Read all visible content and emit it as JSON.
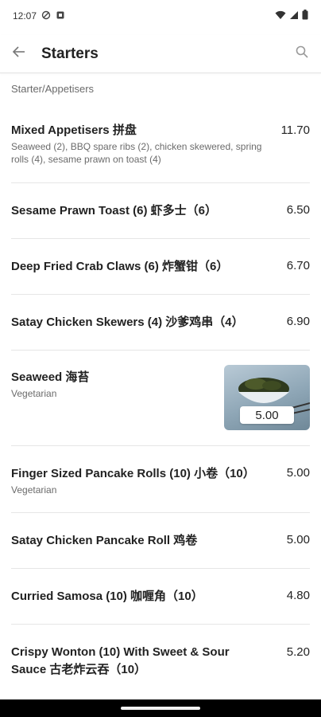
{
  "status": {
    "time": "12:07"
  },
  "header": {
    "title": "Starters"
  },
  "section": {
    "label": "Starter/Appetisers"
  },
  "items": [
    {
      "name": "Mixed Appetisers 拼盘",
      "description": "Seaweed (2), BBQ spare ribs (2), chicken skewered, spring rolls (4), sesame prawn on toast (4)",
      "price": "11.70"
    },
    {
      "name": "Sesame Prawn Toast (6) 虾多士（6）",
      "price": "6.50"
    },
    {
      "name": "Deep Fried Crab Claws (6) 炸蟹钳（6）",
      "price": "6.70"
    },
    {
      "name": "Satay Chicken Skewers (4) 沙爹鸡串（4）",
      "price": "6.90"
    },
    {
      "name": "Seaweed 海苔",
      "description": "Vegetarian",
      "price": "5.00"
    },
    {
      "name": "Finger Sized Pancake Rolls (10) 小卷（10）",
      "description": "Vegetarian",
      "price": "5.00"
    },
    {
      "name": "Satay Chicken Pancake Roll 鸡卷",
      "price": "5.00"
    },
    {
      "name": "Curried Samosa (10) 咖喱角（10）",
      "price": "4.80"
    },
    {
      "name": "Crispy Wonton (10) With Sweet & Sour Sauce 古老炸云吞（10）",
      "price": "5.20"
    }
  ],
  "colors": {
    "accent": "#222222",
    "muted": "#6b6b6b",
    "divider": "#e6e6e6"
  }
}
